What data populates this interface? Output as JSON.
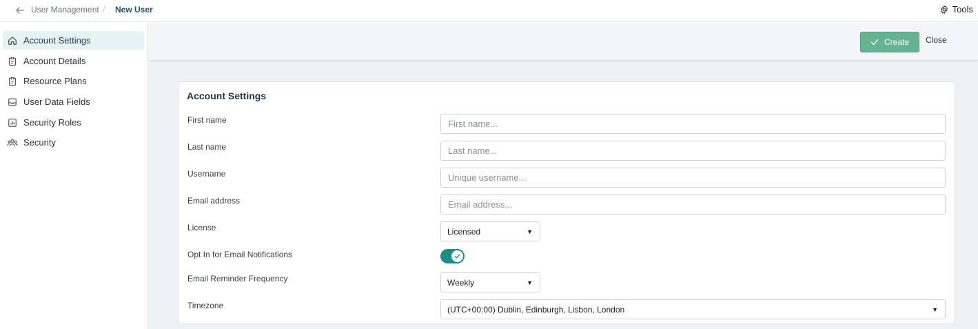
{
  "breadcrumb": {
    "parent": "User Management",
    "separator": "/",
    "current": "New User"
  },
  "header": {
    "tools_label": "Tools",
    "tools_icon": "gear-icon"
  },
  "sidebar": {
    "items": [
      {
        "label": "Account Settings",
        "icon": "home-icon",
        "active": true
      },
      {
        "label": "Account Details",
        "icon": "clipboard-icon"
      },
      {
        "label": "Resource Plans",
        "icon": "clipboard-icon"
      },
      {
        "label": "User Data Fields",
        "icon": "inbox-icon"
      },
      {
        "label": "Security Roles",
        "icon": "chart-icon"
      },
      {
        "label": "Security",
        "icon": "users-icon"
      }
    ]
  },
  "actions": {
    "create_label": "Create",
    "close_label": "Close"
  },
  "form": {
    "title": "Account Settings",
    "first_name": {
      "label": "First name",
      "placeholder": "First name...",
      "value": ""
    },
    "last_name": {
      "label": "Last name",
      "placeholder": "Last name...",
      "value": ""
    },
    "username": {
      "label": "Username",
      "placeholder": "Unique username...",
      "value": ""
    },
    "email": {
      "label": "Email address",
      "placeholder": "Email address...",
      "value": ""
    },
    "license": {
      "label": "License",
      "value": "Licensed"
    },
    "opt_in": {
      "label": "Opt In for Email Notifications",
      "checked": true
    },
    "reminder": {
      "label": "Email Reminder Frequency",
      "value": "Weekly"
    },
    "timezone": {
      "label": "Timezone",
      "value": "(UTC+00:00) Dublin, Edinburgh, Lisbon, London"
    }
  },
  "colors": {
    "accent": "#1a8c8c",
    "create_button": "#66b391",
    "active_nav": "#e5f3f1",
    "main_bg": "#eef2f7"
  }
}
